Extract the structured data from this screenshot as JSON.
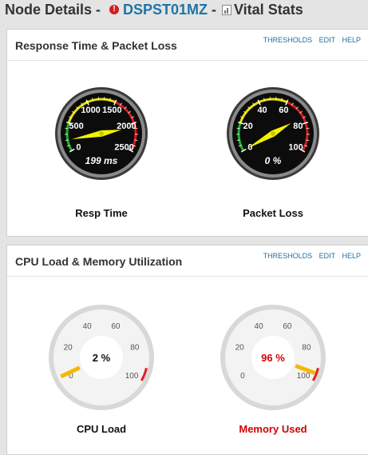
{
  "header": {
    "prefix": "Node Details -",
    "node_name": "DSPST01MZ",
    "separator": "-",
    "section": "Vital Stats",
    "alert_icon": "alert-icon",
    "chart_icon": "chart-icon"
  },
  "panels": [
    {
      "title": "Response Time & Packet Loss",
      "links": [
        "THRESHOLDS",
        "EDIT",
        "HELP"
      ],
      "gauges": [
        {
          "label": "Resp Time",
          "readout": "199 ms",
          "value": 199,
          "min": 0,
          "max": 2500,
          "ticks": [
            "0",
            "500",
            "1000",
            "1500",
            "2000",
            "2500"
          ],
          "style": "dark"
        },
        {
          "label": "Packet Loss",
          "readout": "0 %",
          "value": 0,
          "min": 0,
          "max": 100,
          "ticks": [
            "0",
            "20",
            "40",
            "60",
            "80",
            "100"
          ],
          "style": "dark"
        }
      ]
    },
    {
      "title": "CPU Load & Memory Utilization",
      "links": [
        "THRESHOLDS",
        "EDIT",
        "HELP"
      ],
      "gauges": [
        {
          "label": "CPU Load",
          "readout": "2 %",
          "value": 2,
          "min": 0,
          "max": 100,
          "ticks": [
            "0",
            "20",
            "40",
            "60",
            "80",
            "100"
          ],
          "style": "light",
          "alert": false
        },
        {
          "label": "Memory Used",
          "readout": "96 %",
          "value": 96,
          "min": 0,
          "max": 100,
          "ticks": [
            "0",
            "20",
            "40",
            "60",
            "80",
            "100"
          ],
          "style": "light",
          "alert": true
        }
      ]
    }
  ],
  "colors": {
    "link": "#1f6f9e",
    "node": "#1f73a8",
    "alert": "#d40000",
    "needle_dark": "#f2f200",
    "needle_light": "#f5b800"
  }
}
